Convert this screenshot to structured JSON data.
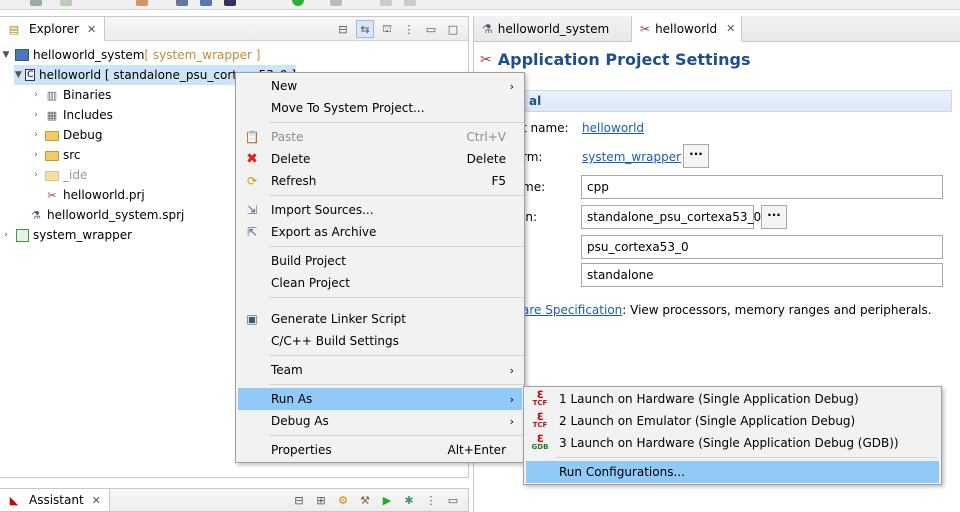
{
  "explorer": {
    "tab_label": "Explorer",
    "tree": [
      {
        "label": "helloworld_system",
        "suffix": " [ system_wrapper ]",
        "icon": "system-project-icon",
        "twisty": "▼"
      },
      {
        "label": "helloworld [ standalone_psu_cortexa53_0 ]",
        "icon": "app-project-icon",
        "twisty": "▼"
      },
      {
        "label": "Binaries",
        "icon": "binaries-icon",
        "twisty": "›"
      },
      {
        "label": "Includes",
        "icon": "includes-icon",
        "twisty": "›"
      },
      {
        "label": "Debug",
        "icon": "folder-icon",
        "twisty": "›"
      },
      {
        "label": "src",
        "icon": "folder-icon",
        "twisty": "›"
      },
      {
        "label": "_ide",
        "icon": "folder-icon",
        "twisty": "›"
      },
      {
        "label": "helloworld.prj",
        "icon": "prj-file-icon",
        "twisty": ""
      },
      {
        "label": "helloworld_system.sprj",
        "icon": "sprj-file-icon",
        "twisty": ""
      },
      {
        "label": "system_wrapper",
        "icon": "platform-icon",
        "twisty": "›"
      }
    ]
  },
  "assistant": {
    "tab_label": "Assistant"
  },
  "editor": {
    "tabs": [
      "helloworld_system",
      "helloworld"
    ],
    "title": "Application Project Settings",
    "section": "al",
    "fields": {
      "project_name_label": "t name:",
      "project_name_link": "helloworld",
      "platform_label": "rm:",
      "platform_link": "system_wrapper",
      "runtime_label": "me:",
      "runtime_value": "cpp",
      "domain_label": "in:",
      "domain_value": "standalone_psu_cortexa53_0",
      "cpu_value": "psu_cortexa53_0",
      "os_value": "standalone",
      "hw_spec_link": "are Specification",
      "hw_spec_text": ": View processors, memory ranges and peripherals."
    }
  },
  "context_menu": {
    "items": [
      {
        "label": "New",
        "arrow": "›"
      },
      {
        "label": "Move To System Project..."
      },
      {
        "label": "Paste",
        "accel": "Ctrl+V",
        "disabled": true
      },
      {
        "label": "Delete",
        "accel": "Delete"
      },
      {
        "label": "Refresh",
        "accel": "F5"
      },
      {
        "label": "Import Sources..."
      },
      {
        "label": "Export as Archive"
      },
      {
        "label": "Build Project"
      },
      {
        "label": "Clean Project"
      },
      {
        "label": "Generate Linker Script"
      },
      {
        "label": "C/C++ Build Settings"
      },
      {
        "label": "Team",
        "arrow": "›"
      },
      {
        "label": "Run As",
        "arrow": "›",
        "highlighted": true
      },
      {
        "label": "Debug As",
        "arrow": "›"
      },
      {
        "label": "Properties",
        "accel": "Alt+Enter"
      }
    ]
  },
  "run_as_submenu": {
    "items": [
      {
        "label": "1 Launch on Hardware (Single Application Debug)",
        "badge": "TCF"
      },
      {
        "label": "2 Launch on Emulator (Single Application Debug)",
        "badge": "TCF"
      },
      {
        "label": "3 Launch on Hardware (Single Application Debug (GDB))",
        "badge": "GDB"
      },
      {
        "label": "Run Configurations...",
        "highlighted": true
      }
    ]
  },
  "colors": {
    "selection": "#91c9f7",
    "tree_selection": "#cce4f7",
    "title_blue": "#1e4f8c",
    "link": "#1a5db5"
  }
}
